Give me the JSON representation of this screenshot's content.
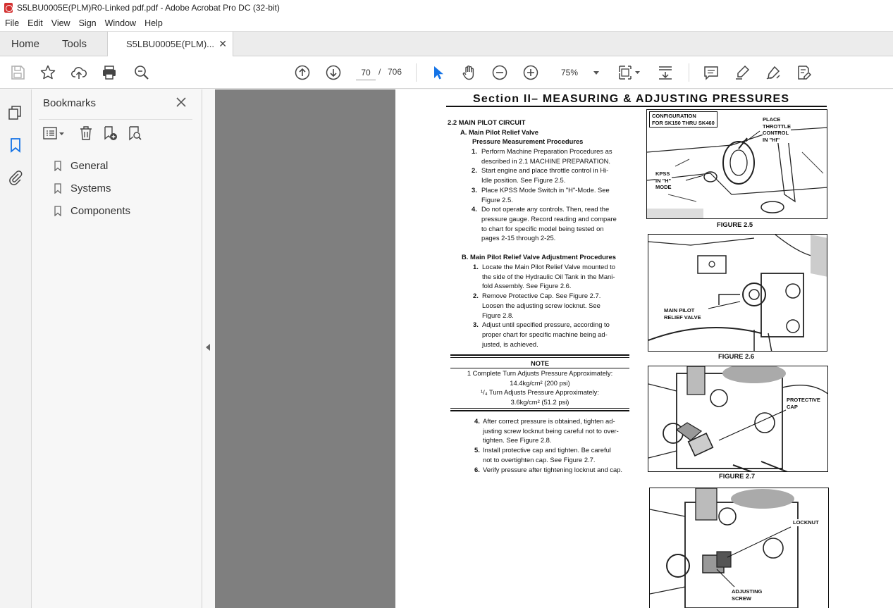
{
  "window": {
    "title": "S5LBU0005E(PLM)R0-Linked pdf.pdf - Adobe Acrobat Pro DC (32-bit)"
  },
  "menu": [
    "File",
    "Edit",
    "View",
    "Sign",
    "Window",
    "Help"
  ],
  "tabs": {
    "home": "Home",
    "tools": "Tools",
    "document": "S5LBU0005E(PLM)..."
  },
  "toolbar": {
    "page_current": "70",
    "page_separator": "/",
    "page_total": "706",
    "zoom": "75%"
  },
  "bookmarks": {
    "title": "Bookmarks",
    "items": [
      {
        "label": "General"
      },
      {
        "label": "Systems"
      },
      {
        "label": "Components"
      }
    ]
  },
  "pdf": {
    "section_title": "Section II– MEASURING & ADJUSTING PRESSURES",
    "heading": "2.2 MAIN PILOT CIRCUIT",
    "a_title": "A. Main Pilot Relief Valve",
    "a_sub": "Pressure Measurement Procedures",
    "a_steps": [
      [
        "1.",
        "Perform Machine Preparation Procedures as"
      ],
      [
        "",
        "described in 2.1 MACHINE PREPARATION."
      ],
      [
        "2.",
        "Start engine and place throttle control in Hi-"
      ],
      [
        "",
        "Idle position. See Figure 2.5."
      ],
      [
        "3.",
        "Place KPSS Mode Switch in \"H\"-Mode. See"
      ],
      [
        "",
        "Figure 2.5."
      ],
      [
        "4.",
        "Do not operate any controls. Then, read the"
      ],
      [
        "",
        "pressure gauge. Record reading and compare"
      ],
      [
        "",
        "to chart for specific model being tested on"
      ],
      [
        "",
        "pages 2-15 through 2-25."
      ]
    ],
    "b_title": "B. Main Pilot Relief Valve Adjustment Procedures",
    "b_steps": [
      [
        "1.",
        "Locate the Main Pilot Relief Valve mounted to"
      ],
      [
        "",
        "the side of the Hydraulic Oil Tank in the Mani-"
      ],
      [
        "",
        "fold Assembly. See Figure 2.6."
      ],
      [
        "2.",
        "Remove Protective Cap.  See Figure 2.7."
      ],
      [
        "",
        "Loosen the adjusting screw locknut. See"
      ],
      [
        "",
        "Figure 2.8."
      ],
      [
        "3.",
        "Adjust until specified pressure, according to"
      ],
      [
        "",
        "proper chart for specific machine being ad-"
      ],
      [
        "",
        "justed, is achieved."
      ]
    ],
    "note": {
      "title": "NOTE",
      "line1": "1 Complete Turn Adjusts Pressure Approximately:",
      "line2": "14.4kg/cm² (200 psi)",
      "line3": "¹/₄ Turn Adjusts Pressure Approximately:",
      "line4": "3.6kg/cm² (51.2 psi)"
    },
    "c_steps": [
      [
        "4.",
        "After correct pressure is obtained,  tighten ad-"
      ],
      [
        "",
        "justing screw locknut being careful not to over-"
      ],
      [
        "",
        "tighten.  See Figure 2.8."
      ],
      [
        "5.",
        "Install protective cap and tighten. Be careful"
      ],
      [
        "",
        "not to overtighten cap. See Figure 2.7."
      ],
      [
        "6.",
        "Verify pressure after tightening locknut and cap."
      ]
    ],
    "fig25": {
      "caption": "FIGURE 2.5",
      "config": "CONFIGURATION\nFOR SK150 THRU SK460",
      "throttle": "PLACE\nTHROTTLE\nCONTROL\nIN \"HI\"",
      "kpss": "KPSS\nIN \"H\"\nMODE"
    },
    "fig26": {
      "caption": "FIGURE 2.6",
      "label": "MAIN PILOT\nRELIEF VALVE"
    },
    "fig27": {
      "caption": "FIGURE 2.7",
      "label": "PROTECTIVE\nCAP"
    },
    "fig28": {
      "locknut": "LOCKNUT",
      "screw": "ADJUSTING\nSCREW"
    }
  }
}
